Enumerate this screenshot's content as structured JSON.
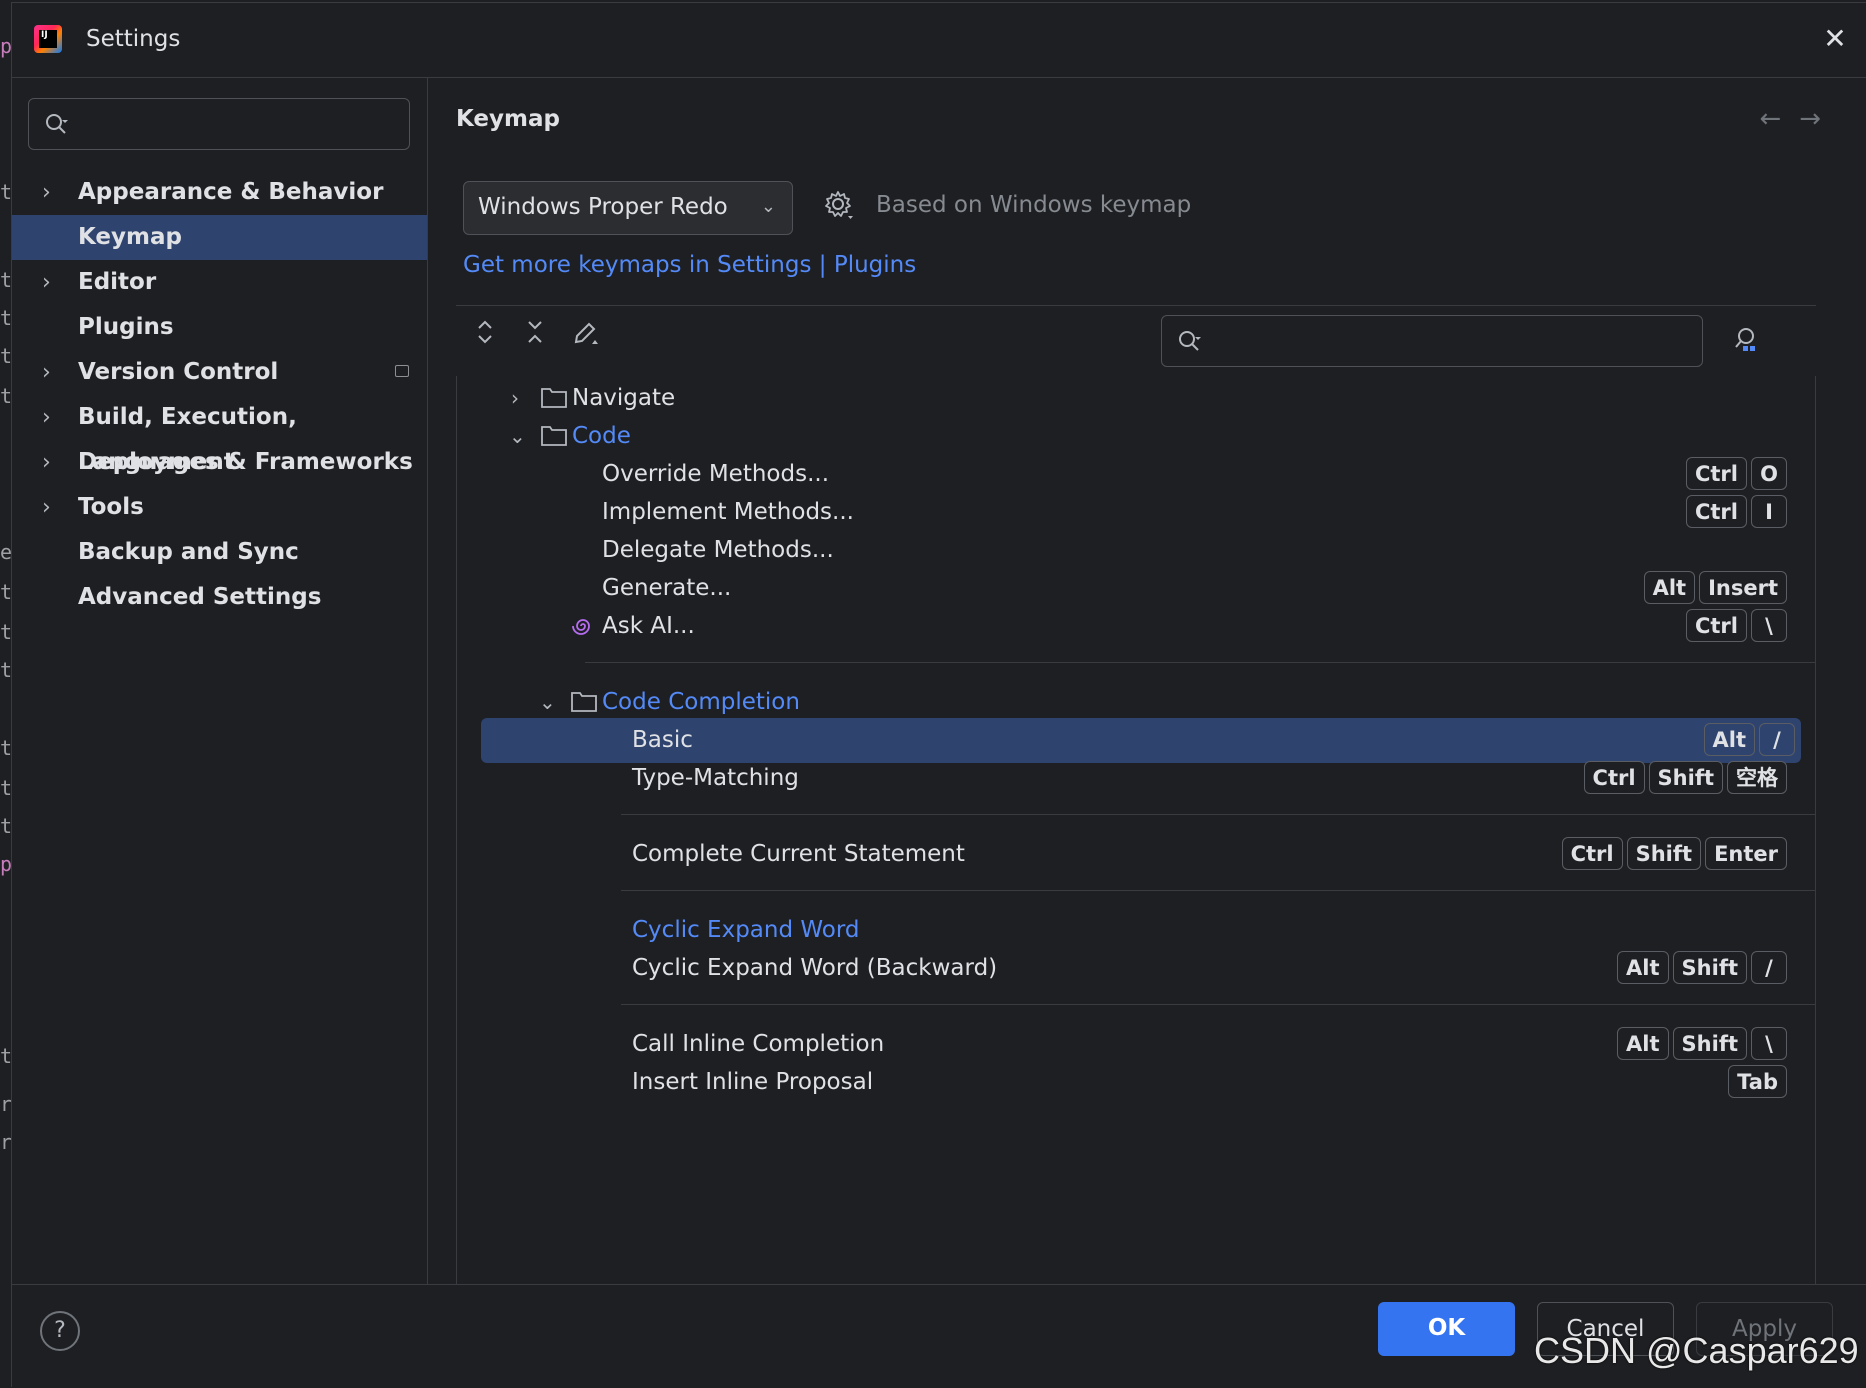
{
  "window": {
    "title": "Settings"
  },
  "sidebar": {
    "search_placeholder": "",
    "items": [
      {
        "label": "Appearance & Behavior",
        "expandable": true
      },
      {
        "label": "Keymap",
        "expandable": false,
        "selected": true
      },
      {
        "label": "Editor",
        "expandable": true
      },
      {
        "label": "Plugins",
        "expandable": false
      },
      {
        "label": "Version Control",
        "expandable": true
      },
      {
        "label": "Build, Execution, Deployment",
        "expandable": true
      },
      {
        "label": "Languages & Frameworks",
        "expandable": true
      },
      {
        "label": "Tools",
        "expandable": true
      },
      {
        "label": "Backup and Sync",
        "expandable": false
      },
      {
        "label": "Advanced Settings",
        "expandable": false
      }
    ]
  },
  "main": {
    "title": "Keymap",
    "keymap_select": "Windows Proper Redo",
    "based_on": "Based on Windows keymap",
    "more_link": "Get more keymaps in Settings | Plugins",
    "search_placeholder": ""
  },
  "tree": {
    "rows": [
      {
        "label": "Navigate",
        "type": "folder",
        "expanded": false,
        "keys": []
      },
      {
        "label": "Code",
        "type": "folder",
        "expanded": true,
        "keys": []
      },
      {
        "label": "Override Methods...",
        "type": "action",
        "keys": [
          "Ctrl",
          "O"
        ]
      },
      {
        "label": "Implement Methods...",
        "type": "action",
        "keys": [
          "Ctrl",
          "I"
        ]
      },
      {
        "label": "Delegate Methods...",
        "type": "action",
        "keys": []
      },
      {
        "label": "Generate...",
        "type": "action",
        "keys": [
          "Alt",
          "Insert"
        ]
      },
      {
        "label": "Ask AI...",
        "type": "action",
        "keys": [
          "Ctrl",
          "\\"
        ]
      },
      {
        "label": "Code Completion",
        "type": "folder",
        "expanded": true,
        "keys": []
      },
      {
        "label": "Basic",
        "type": "action",
        "selected": true,
        "keys": [
          "Alt",
          "/"
        ]
      },
      {
        "label": "Type-Matching",
        "type": "action",
        "keys": [
          "Ctrl",
          "Shift",
          "空格"
        ]
      },
      {
        "label": "Complete Current Statement",
        "type": "action",
        "keys": [
          "Ctrl",
          "Shift",
          "Enter"
        ]
      },
      {
        "label": "Cyclic Expand Word",
        "type": "action",
        "keys": []
      },
      {
        "label": "Cyclic Expand Word (Backward)",
        "type": "action",
        "keys": [
          "Alt",
          "Shift",
          "/"
        ]
      },
      {
        "label": "Call Inline Completion",
        "type": "action",
        "keys": [
          "Alt",
          "Shift",
          "\\"
        ]
      },
      {
        "label": "Insert Inline Proposal",
        "type": "action",
        "keys": [
          "Tab"
        ]
      }
    ]
  },
  "footer": {
    "ok": "OK",
    "cancel": "Cancel",
    "apply": "Apply",
    "help": "?"
  },
  "watermark": "CSDN @Caspar629",
  "colors": {
    "accent": "#3574f0",
    "link": "#548af7",
    "selection": "#2e436e",
    "background": "#1e1f22"
  }
}
